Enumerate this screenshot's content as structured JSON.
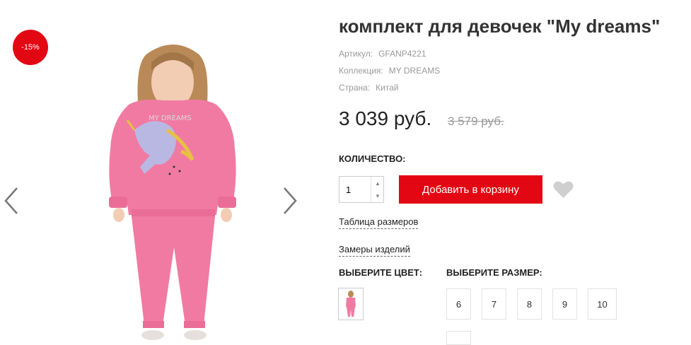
{
  "product": {
    "title": "комплект для девочек \"My dreams\"",
    "discount_badge": "-15%",
    "article_label": "Артикул:",
    "article_value": "GFANP4221",
    "collection_label": "Коллекция:",
    "collection_value": "MY DREAMS",
    "country_label": "Страна:",
    "country_value": "Китай",
    "price": "3 039 руб.",
    "old_price": "3 579 руб."
  },
  "quantity": {
    "label": "КОЛИЧЕСТВО:",
    "value": "1"
  },
  "actions": {
    "add_to_cart": "Добавить в корзину",
    "size_table_link": "Таблица размеров",
    "measurements_link": "Замеры изделий"
  },
  "color": {
    "label": "ВЫБЕРИТЕ ЦВЕТ:"
  },
  "size": {
    "label": "ВЫБЕРИТЕ РАЗМЕР:",
    "options": [
      "6",
      "7",
      "8",
      "9",
      "10"
    ]
  },
  "icons": {
    "prev": "chevron-left-icon",
    "next": "chevron-right-icon",
    "favorite": "heart-icon"
  },
  "colors": {
    "accent": "#e30613",
    "product_pink": "#f17aa3"
  }
}
